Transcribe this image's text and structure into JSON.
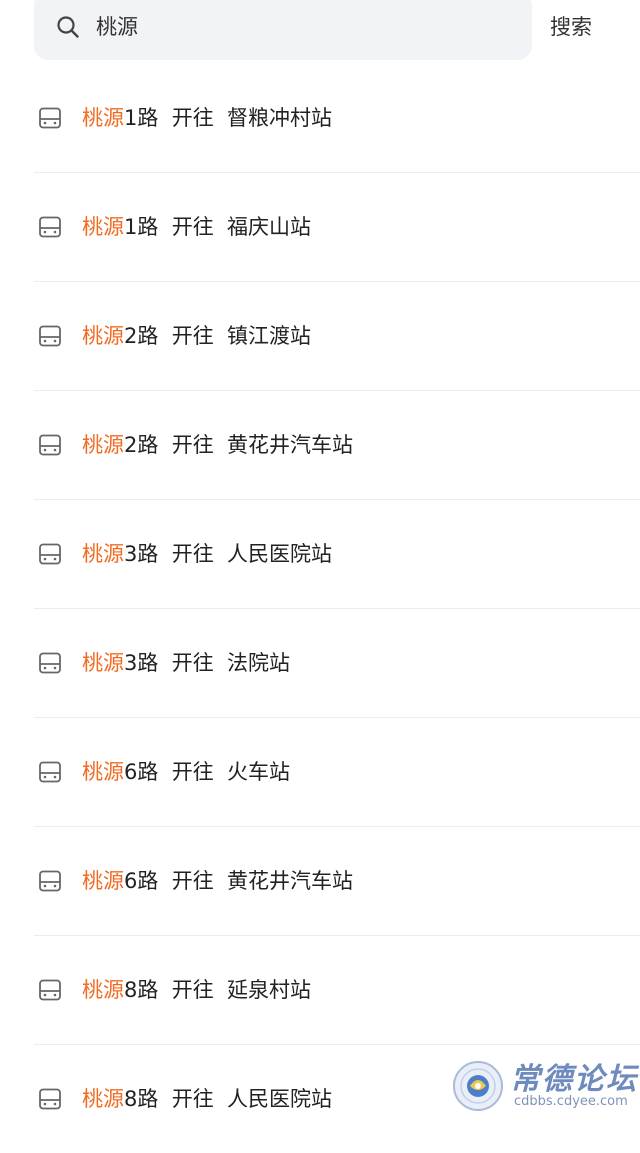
{
  "search": {
    "value": "桃源",
    "button_label": "搜索",
    "icon": "search-icon"
  },
  "results": [
    {
      "keyword": "桃源",
      "text": "1路  开往  督粮冲村站",
      "icon": "bus-icon"
    },
    {
      "keyword": "桃源",
      "text": "1路  开往  福庆山站",
      "icon": "bus-icon"
    },
    {
      "keyword": "桃源",
      "text": "2路  开往  镇江渡站",
      "icon": "bus-icon"
    },
    {
      "keyword": "桃源",
      "text": "2路  开往  黄花井汽车站",
      "icon": "bus-icon"
    },
    {
      "keyword": "桃源",
      "text": "3路  开往  人民医院站",
      "icon": "bus-icon"
    },
    {
      "keyword": "桃源",
      "text": "3路  开往  法院站",
      "icon": "bus-icon"
    },
    {
      "keyword": "桃源",
      "text": "6路  开往  火车站",
      "icon": "bus-icon"
    },
    {
      "keyword": "桃源",
      "text": "6路  开往  黄花井汽车站",
      "icon": "bus-icon"
    },
    {
      "keyword": "桃源",
      "text": "8路  开往  延泉村站",
      "icon": "bus-icon"
    },
    {
      "keyword": "桃源",
      "text": "8路  开往  人民医院站",
      "icon": "bus-icon"
    }
  ],
  "watermark": {
    "title": "常德论坛",
    "url": "cdbbs.cdyee.com"
  },
  "colors": {
    "keyword_highlight": "#f26b21",
    "search_bg": "#f2f3f6",
    "divider": "#ececec",
    "text": "#222222",
    "icon": "#666666",
    "watermark": "#6f8bbd"
  }
}
